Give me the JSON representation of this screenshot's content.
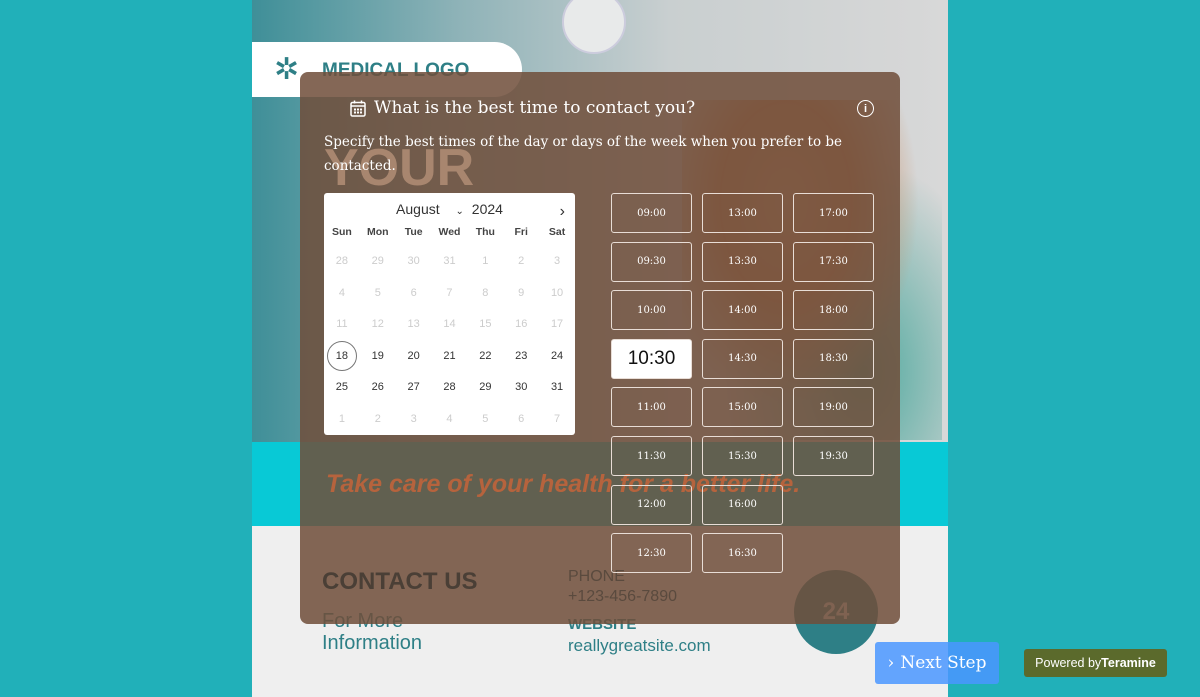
{
  "poster": {
    "logo": "MEDICAL LOGO",
    "headline_partial": "YOUR",
    "tagline": "Take care of your health for a better life.",
    "contact_title": "CONTACT US",
    "more": "For More Information",
    "phone_label": "PHONE",
    "phone": "+123-456-7890",
    "website_label": "WEBSITE",
    "website": "reallygreatsite.com",
    "badge": "24"
  },
  "question": {
    "title": "What is the best time to contact you?",
    "description": "Specify the best times of the day or days of the week when you prefer to be contacted."
  },
  "calendar": {
    "month": "August",
    "year": "2024",
    "weekdays": [
      "Sun",
      "Mon",
      "Tue",
      "Wed",
      "Thu",
      "Fri",
      "Sat"
    ],
    "days": [
      [
        "28",
        1
      ],
      [
        "29",
        1
      ],
      [
        "30",
        1
      ],
      [
        "31",
        1
      ],
      [
        "1",
        1
      ],
      [
        "2",
        1
      ],
      [
        "3",
        1
      ],
      [
        "4",
        1
      ],
      [
        "5",
        1
      ],
      [
        "6",
        1
      ],
      [
        "7",
        1
      ],
      [
        "8",
        1
      ],
      [
        "9",
        1
      ],
      [
        "10",
        1
      ],
      [
        "11",
        1
      ],
      [
        "12",
        1
      ],
      [
        "13",
        1
      ],
      [
        "14",
        1
      ],
      [
        "15",
        1
      ],
      [
        "16",
        1
      ],
      [
        "17",
        1
      ],
      [
        "18",
        2
      ],
      [
        "19",
        0
      ],
      [
        "20",
        0
      ],
      [
        "21",
        0
      ],
      [
        "22",
        0
      ],
      [
        "23",
        0
      ],
      [
        "24",
        0
      ],
      [
        "25",
        0
      ],
      [
        "26",
        0
      ],
      [
        "27",
        0
      ],
      [
        "28",
        0
      ],
      [
        "29",
        0
      ],
      [
        "30",
        0
      ],
      [
        "31",
        0
      ],
      [
        "1",
        1
      ],
      [
        "2",
        1
      ],
      [
        "3",
        1
      ],
      [
        "4",
        1
      ],
      [
        "5",
        1
      ],
      [
        "6",
        1
      ],
      [
        "7",
        1
      ]
    ],
    "selected_day": "18"
  },
  "time_slots": [
    [
      "09:00",
      "09:30",
      "10:00",
      "10:30",
      "11:00",
      "11:30",
      "12:00",
      "12:30"
    ],
    [
      "13:00",
      "13:30",
      "14:00",
      "14:30",
      "15:00",
      "15:30",
      "16:00",
      "16:30"
    ],
    [
      "17:00",
      "17:30",
      "18:00",
      "18:30",
      "19:00",
      "19:30"
    ]
  ],
  "selected_time": "10:30",
  "next_step": "Next Step",
  "powered": {
    "prefix": "Powered by",
    "brand": "Teramine"
  }
}
